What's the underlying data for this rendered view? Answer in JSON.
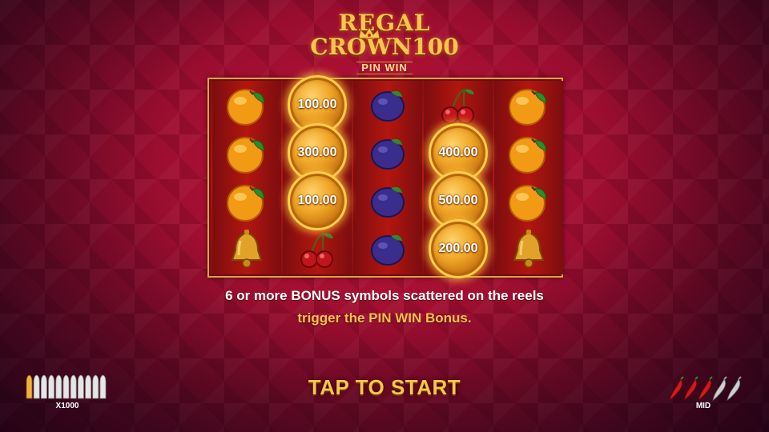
{
  "game": {
    "logo": {
      "line1": "REGAL",
      "line2": "CROWN100",
      "line3": "PIN WIN"
    },
    "reels": [
      [
        "orange",
        "orange",
        "orange",
        "bell"
      ],
      [
        "coin",
        "coin",
        "coin",
        "cherry"
      ],
      [
        "plum",
        "plum",
        "plum",
        "plum"
      ],
      [
        "cherry",
        "coin",
        "coin",
        "coin"
      ],
      [
        "orange",
        "orange",
        "orange",
        "bell"
      ]
    ],
    "coins": [
      {
        "reel": 1,
        "row": 0,
        "value": "100.00"
      },
      {
        "reel": 1,
        "row": 1,
        "value": "300.00"
      },
      {
        "reel": 1,
        "row": 2,
        "value": "100.00"
      },
      {
        "reel": 3,
        "row": 1,
        "value": "400.00"
      },
      {
        "reel": 3,
        "row": 2,
        "value": "500.00"
      },
      {
        "reel": 3,
        "row": 3,
        "value": "200.00"
      }
    ],
    "info": {
      "line1_a": "6 or more ",
      "line1_b": "BONUS symbols scattered on the reels",
      "line2": "trigger the PIN WIN Bonus."
    },
    "start_label": "TAP TO START",
    "max_win": {
      "label": "X1000",
      "icon": "bullets-icon",
      "filled": 1,
      "total": 11
    },
    "volatility": {
      "label": "MID",
      "icon": "chili-pepper-icon",
      "filled": 3,
      "total": 5
    },
    "colors": {
      "gold": "#f7c64a",
      "background": "#9a0d2f",
      "frame": "#e0a33a"
    }
  }
}
